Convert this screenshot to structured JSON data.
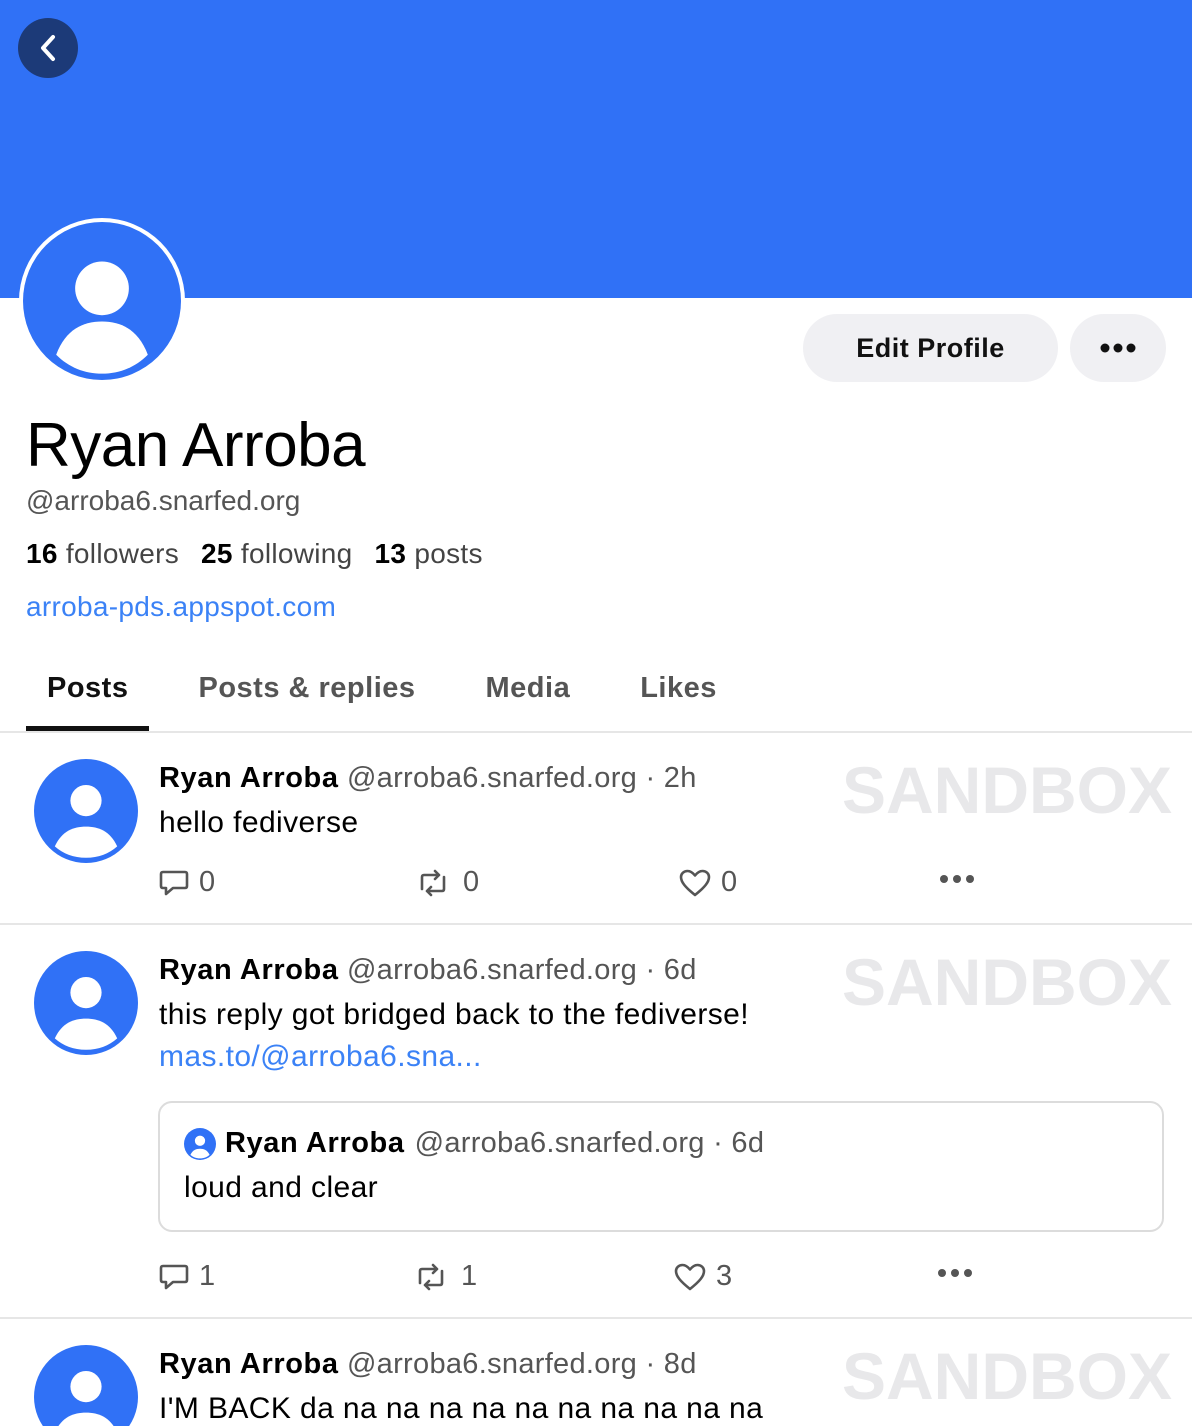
{
  "colors": {
    "banner": "#3071f6",
    "accent": "#3b82f6"
  },
  "profile": {
    "display_name": "Ryan Arroba",
    "handle": "@arroba6.snarfed.org",
    "followers_count": "16",
    "followers_label": "followers",
    "following_count": "25",
    "following_label": "following",
    "posts_count": "13",
    "posts_label": "posts",
    "website": "arroba-pds.appspot.com",
    "edit_button": "Edit Profile",
    "more_button_icon": "ellipsis-icon",
    "back_button_icon": "chevron-left-icon"
  },
  "tabs": [
    {
      "label": "Posts",
      "active": true
    },
    {
      "label": "Posts & replies",
      "active": false
    },
    {
      "label": "Media",
      "active": false
    },
    {
      "label": "Likes",
      "active": false
    }
  ],
  "watermark": "SANDBOX",
  "posts": [
    {
      "author": "Ryan Arroba",
      "meta": "@arroba6.snarfed.org · 2h",
      "text": "hello fediverse",
      "replies": "0",
      "reposts": "0",
      "likes": "0"
    },
    {
      "author": "Ryan Arroba",
      "meta": "@arroba6.snarfed.org · 6d",
      "text": "this reply got bridged back to the fediverse!",
      "link": "mas.to/@arroba6.sna...",
      "quote": {
        "author": "Ryan Arroba",
        "meta": "@arroba6.snarfed.org · 6d",
        "text": "loud and clear"
      },
      "replies": "1",
      "reposts": "1",
      "likes": "3"
    },
    {
      "author": "Ryan Arroba",
      "meta": "@arroba6.snarfed.org · 8d",
      "text": "I'M BACK da na na na na na na na na na na"
    }
  ]
}
